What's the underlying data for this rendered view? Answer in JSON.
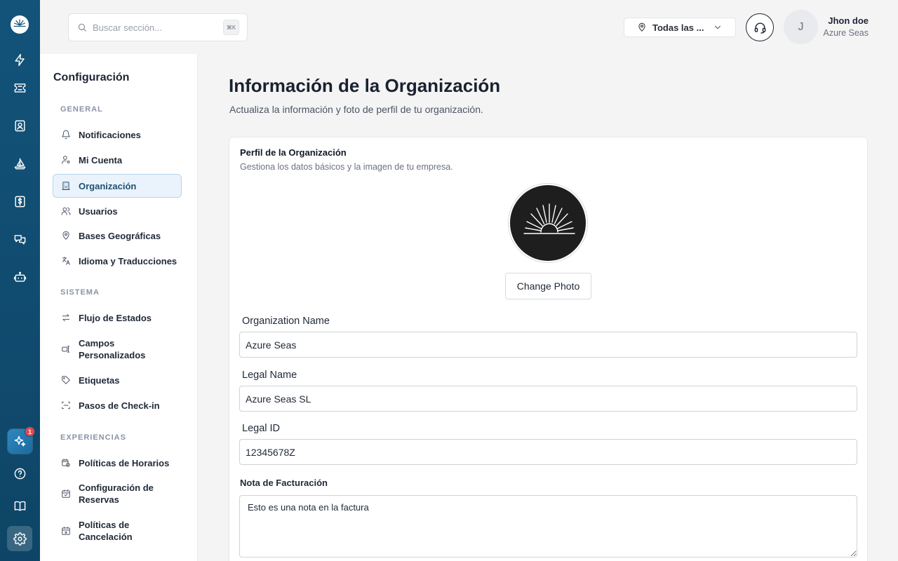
{
  "rail": {
    "logo_icon": "sunrise-logo-icon",
    "items": [
      {
        "icon": "lightning-icon"
      },
      {
        "icon": "ticket-icon"
      },
      {
        "icon": "contact-badge-icon"
      },
      {
        "icon": "sailboat-icon"
      },
      {
        "icon": "invoice-dollar-icon"
      },
      {
        "icon": "chat-bubbles-icon"
      },
      {
        "icon": "bot-icon"
      }
    ],
    "ai_badge_count": "1",
    "bottom": [
      {
        "icon": "help-circle-icon"
      },
      {
        "icon": "book-icon"
      },
      {
        "icon": "gear-icon"
      }
    ],
    "colors": {
      "rail_top": "#13537a",
      "badge": "#e5484d"
    }
  },
  "topbar": {
    "search_placeholder": "Buscar sección...",
    "search_shortcut": "⌘K",
    "location_label": "Todas las ...",
    "user": {
      "initial": "J",
      "name": "Jhon doe",
      "org": "Azure Seas"
    }
  },
  "settings_nav": {
    "title": "Configuración",
    "sections": {
      "general": "GENERAL",
      "sistema": "SISTEMA",
      "experiencias": "EXPERIENCIAS"
    },
    "items": {
      "notificaciones": "Notificaciones",
      "mi_cuenta": "Mi Cuenta",
      "organizacion": "Organización",
      "usuarios": "Usuarios",
      "bases": "Bases Geográficas",
      "idioma": "Idioma y Traducciones",
      "flujo": "Flujo de Estados",
      "campos": "Campos Personalizados",
      "etiquetas": "Etiquetas",
      "checkin": "Pasos de Check-in",
      "horarios": "Políticas de Horarios",
      "reservas": "Configuración de Reservas",
      "cancelacion": "Políticas de Cancelación"
    },
    "active_item": "Organización"
  },
  "main": {
    "title": "Información de la Organización",
    "subtitle": "Actualiza la información y foto de perfil de tu organización.",
    "card": {
      "title": "Perfil de la Organización",
      "subtitle": "Gestiona los datos básicos y la imagen de tu empresa.",
      "change_photo": "Change Photo",
      "org_name_label": "Organization Name",
      "org_name_value": "Azure Seas",
      "legal_name_label": "Legal Name",
      "legal_name_value": "Azure Seas SL",
      "legal_id_label": "Legal ID",
      "legal_id_value": "12345678Z",
      "billing_note_label": "Nota de Facturación",
      "billing_note_value": "Esto es una nota en la factura"
    }
  }
}
